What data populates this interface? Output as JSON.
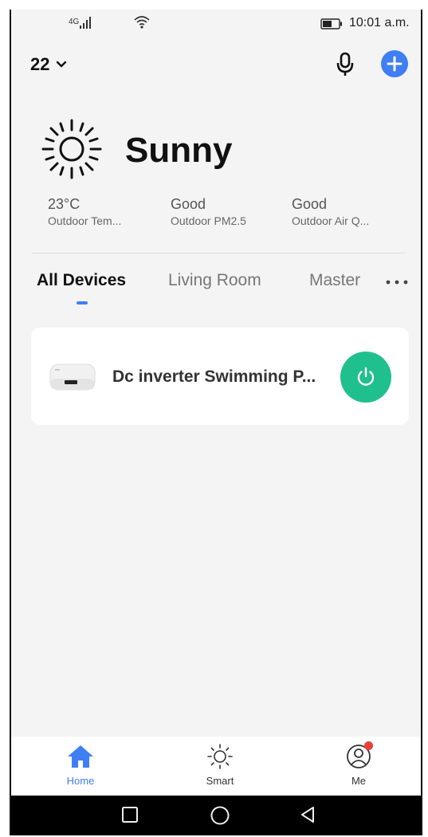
{
  "status_bar": {
    "network": "4G",
    "time": "10:01 a.m."
  },
  "header": {
    "home_name": "22",
    "icons": [
      "chevron-down-icon",
      "microphone-icon",
      "add-icon"
    ]
  },
  "weather": {
    "condition": "Sunny",
    "icon": "sun-icon",
    "metrics": [
      {
        "value": "23°C",
        "label": "Outdoor Tem..."
      },
      {
        "value": "Good",
        "label": "Outdoor PM2.5"
      },
      {
        "value": "Good",
        "label": "Outdoor Air Q..."
      }
    ]
  },
  "tabs": {
    "items": [
      {
        "label": "All Devices"
      },
      {
        "label": "Living Room"
      },
      {
        "label": "Master"
      }
    ],
    "active_index": 0,
    "more_icon": "more-dots-icon"
  },
  "devices": [
    {
      "name": "Dc inverter Swimming P...",
      "power_icon": "power-icon"
    }
  ],
  "bottom_nav": {
    "items": [
      {
        "label": "Home",
        "icon": "home-icon",
        "active": true
      },
      {
        "label": "Smart",
        "icon": "smart-sun-icon",
        "active": false
      },
      {
        "label": "Me",
        "icon": "profile-icon",
        "active": false,
        "badge": true
      }
    ]
  },
  "system_nav": {
    "buttons": [
      "recent-apps-icon",
      "home-circle-icon",
      "back-icon"
    ]
  },
  "colors": {
    "accent": "#3f7ef5",
    "power_green": "#1fc08e",
    "badge_red": "#e8403b",
    "background": "#f4f4f4"
  }
}
